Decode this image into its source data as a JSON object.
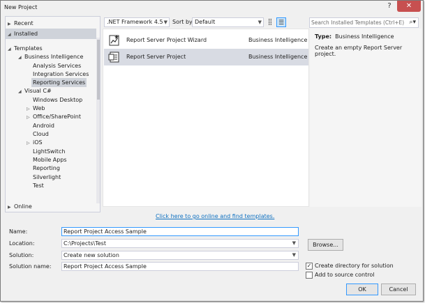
{
  "window": {
    "title": "New Project",
    "help_icon": "?",
    "close_icon": "✕"
  },
  "tree": {
    "recent": "Recent",
    "installed": "Installed",
    "templates": "Templates",
    "business_intelligence": "Business Intelligence",
    "bi_children": [
      "Analysis Services",
      "Integration Services",
      "Reporting Services"
    ],
    "visual_csharp": "Visual C#",
    "cs_children": [
      "Windows Desktop",
      "Web",
      "Office/SharePoint",
      "Android",
      "Cloud",
      "iOS",
      "LightSwitch",
      "Mobile Apps",
      "Reporting",
      "Silverlight",
      "Test"
    ],
    "online": "Online"
  },
  "toolbar": {
    "framework": ".NET Framework 4.5",
    "sort_by_label": "Sort by:",
    "sort_by_value": "Default"
  },
  "search": {
    "placeholder": "Search Installed Templates (Ctrl+E)"
  },
  "templates": [
    {
      "name": "Report Server Project Wizard",
      "category": "Business Intelligence"
    },
    {
      "name": "Report Server Project",
      "category": "Business Intelligence"
    }
  ],
  "details": {
    "type_label": "Type:",
    "type_value": "Business Intelligence",
    "description": "Create an empty Report Server project."
  },
  "online_link": "Click here to go online and find templates.",
  "form": {
    "name_label": "Name:",
    "name_value": "Report Project Access Sample",
    "location_label": "Location:",
    "location_value": "C:\\Projects\\Test",
    "solution_label": "Solution:",
    "solution_value": "Create new solution",
    "solution_name_label": "Solution name:",
    "solution_name_value": "Report Project Access Sample",
    "browse": "Browse...",
    "create_dir": "Create directory for solution",
    "add_source_control": "Add to source control",
    "ok": "OK",
    "cancel": "Cancel"
  },
  "state": {
    "create_dir_checked": true,
    "add_source_control_checked": false
  }
}
